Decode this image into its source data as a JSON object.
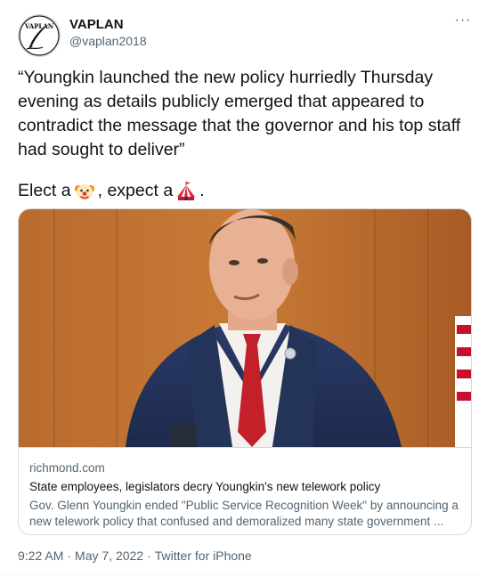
{
  "author": {
    "name": "VAPLAN",
    "handle": "@vaplan2018",
    "avatar_icon": "vaplan-quill-logo",
    "avatar_text": "VAPLAN"
  },
  "more_label": "···",
  "tweet": {
    "text": "“Youngkin launched the new policy hurriedly Thursday evening as details publicly emerged that appeared to contradict the message that the governor and his top staff had sought to deliver”",
    "line2_part1": "Elect a",
    "emoji1": "clown-face-emoji",
    "line2_part2": ", expect a",
    "emoji2": "circus-tent-emoji",
    "line2_part3": "."
  },
  "card": {
    "image_icon": "photo-man-at-podium",
    "domain": "richmond.com",
    "title": "State employees, legislators decry Youngkin's new telework policy",
    "description": "Gov. Glenn Youngkin ended \"Public Service Recognition Week\" by announcing a new telework policy that confused and demoralized many state government ..."
  },
  "meta": {
    "time": "9:22 AM",
    "separator1": "·",
    "date": "May 7, 2022",
    "separator2": "·",
    "source": "Twitter for iPhone"
  },
  "colors": {
    "text": "#0f1419",
    "secondary": "#536471",
    "border": "#cfd9de"
  }
}
